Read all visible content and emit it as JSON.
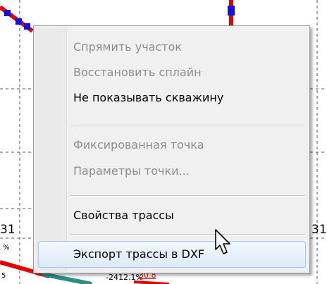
{
  "background_plot": {
    "left_label": "31",
    "left_label_prefix": "3",
    "right_label": "31",
    "small_left_label": "%",
    "small_left_label2": "5",
    "bottom_percent_label": "-2412.1%",
    "bottom_red_label": "30.8",
    "trace_colors": {
      "red": "#e60000",
      "blue": "#1010e0",
      "teal": "#2a8f86",
      "grid": "#555555"
    }
  },
  "context_menu": {
    "items": [
      {
        "label": "Спрямить участок",
        "enabled": false
      },
      {
        "label": "Восстановить сплайн",
        "enabled": false
      },
      {
        "label": "Не показывать скважину",
        "enabled": true
      },
      {
        "label": "Фиксированная точка",
        "enabled": false
      },
      {
        "label": "Параметры точки...",
        "enabled": false
      },
      {
        "label": "Свойства трассы",
        "enabled": true
      },
      {
        "label": "Экспорт трассы в DXF",
        "enabled": true,
        "highlighted": true
      }
    ],
    "colors": {
      "background": "#f0f0f0",
      "disabled_text": "#8d8d8d",
      "highlight": "#dce9f6"
    }
  },
  "cursor": {
    "type": "arrow-pointer"
  }
}
